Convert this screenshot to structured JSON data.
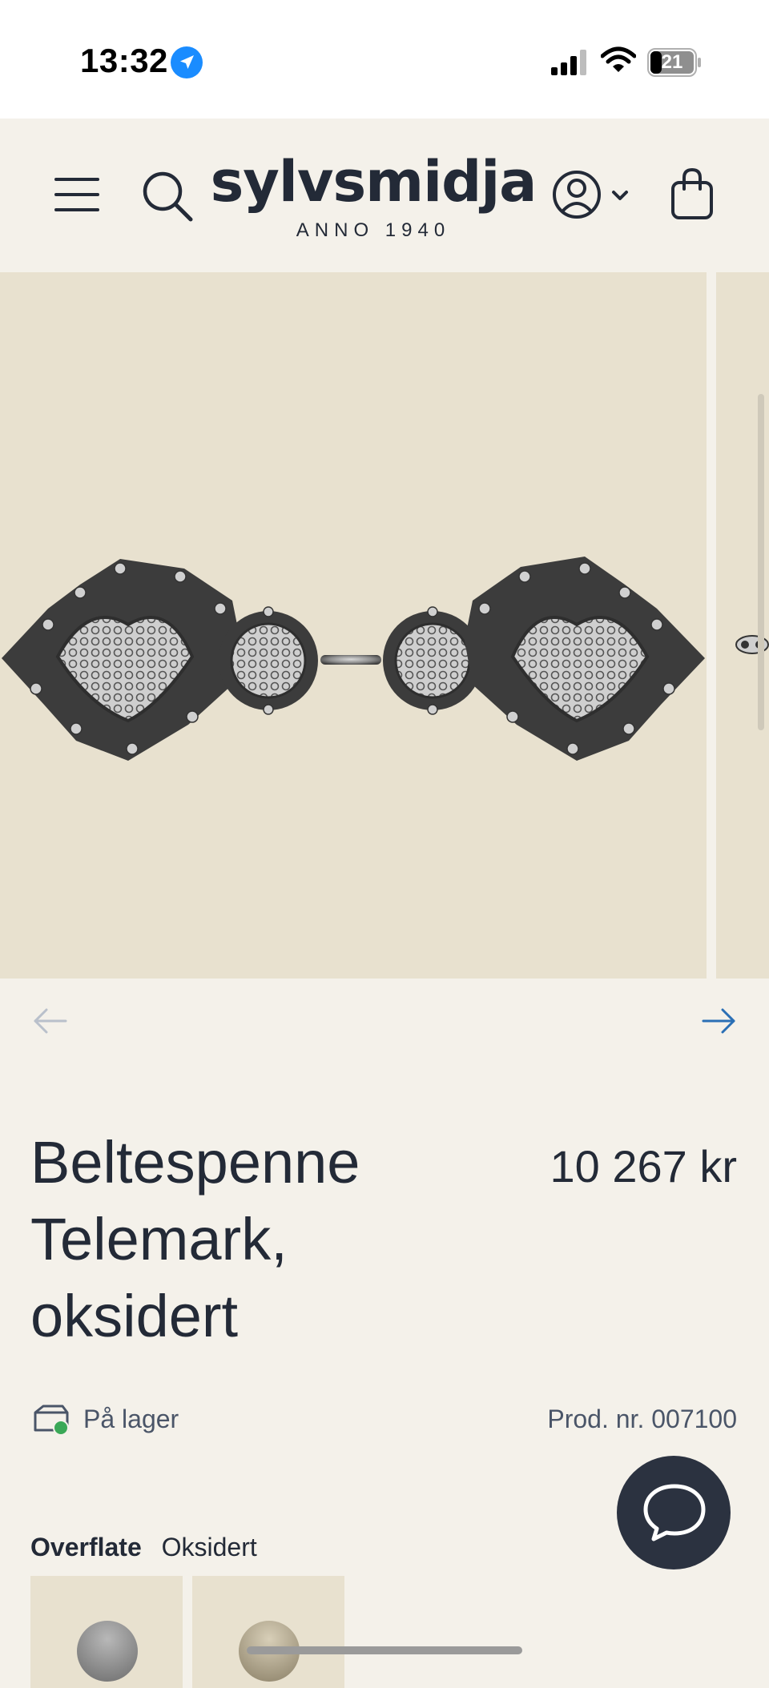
{
  "status_bar": {
    "time": "13:32",
    "battery": "21"
  },
  "header": {
    "brand_name": "sylvsmidja",
    "brand_tagline": "ANNO 1940"
  },
  "product": {
    "title": "Beltespenne Telemark, oksidert",
    "price": "10 267 kr",
    "stock_status": "På lager",
    "product_number": "Prod. nr. 007100"
  },
  "options": {
    "label": "Overflate",
    "value": "Oksidert"
  },
  "icons": {
    "menu": "menu-icon",
    "search": "search-icon",
    "account": "user-icon",
    "cart": "shopping-bag-icon",
    "chat": "chat-bubble-icon",
    "prev": "arrow-left-icon",
    "next": "arrow-right-icon",
    "stock": "package-in-stock-icon"
  },
  "colors": {
    "background": "#f4f1ea",
    "image_background": "#e8e1cf",
    "text": "#232a37",
    "accent_link": "#2a6fb5",
    "chat_button": "#2b3240",
    "stock_indicator": "#3aa857"
  }
}
